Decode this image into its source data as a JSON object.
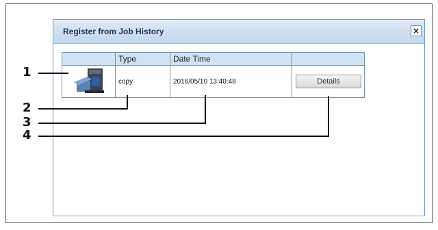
{
  "dialog": {
    "title": "Register from Job History",
    "close_icon": "close-icon"
  },
  "table": {
    "headers": [
      "",
      "Type",
      "Date Time",
      ""
    ],
    "rows": [
      {
        "icon": "copier-icon",
        "type": "copy",
        "date_time": "2016/05/10 13:40:48",
        "action_label": "Details"
      }
    ]
  },
  "callouts": [
    "1",
    "2",
    "3",
    "4"
  ],
  "colors": {
    "titlebar": "#c3d6ec",
    "table_header": "#cfe3f4",
    "border": "#7a8fa8"
  }
}
